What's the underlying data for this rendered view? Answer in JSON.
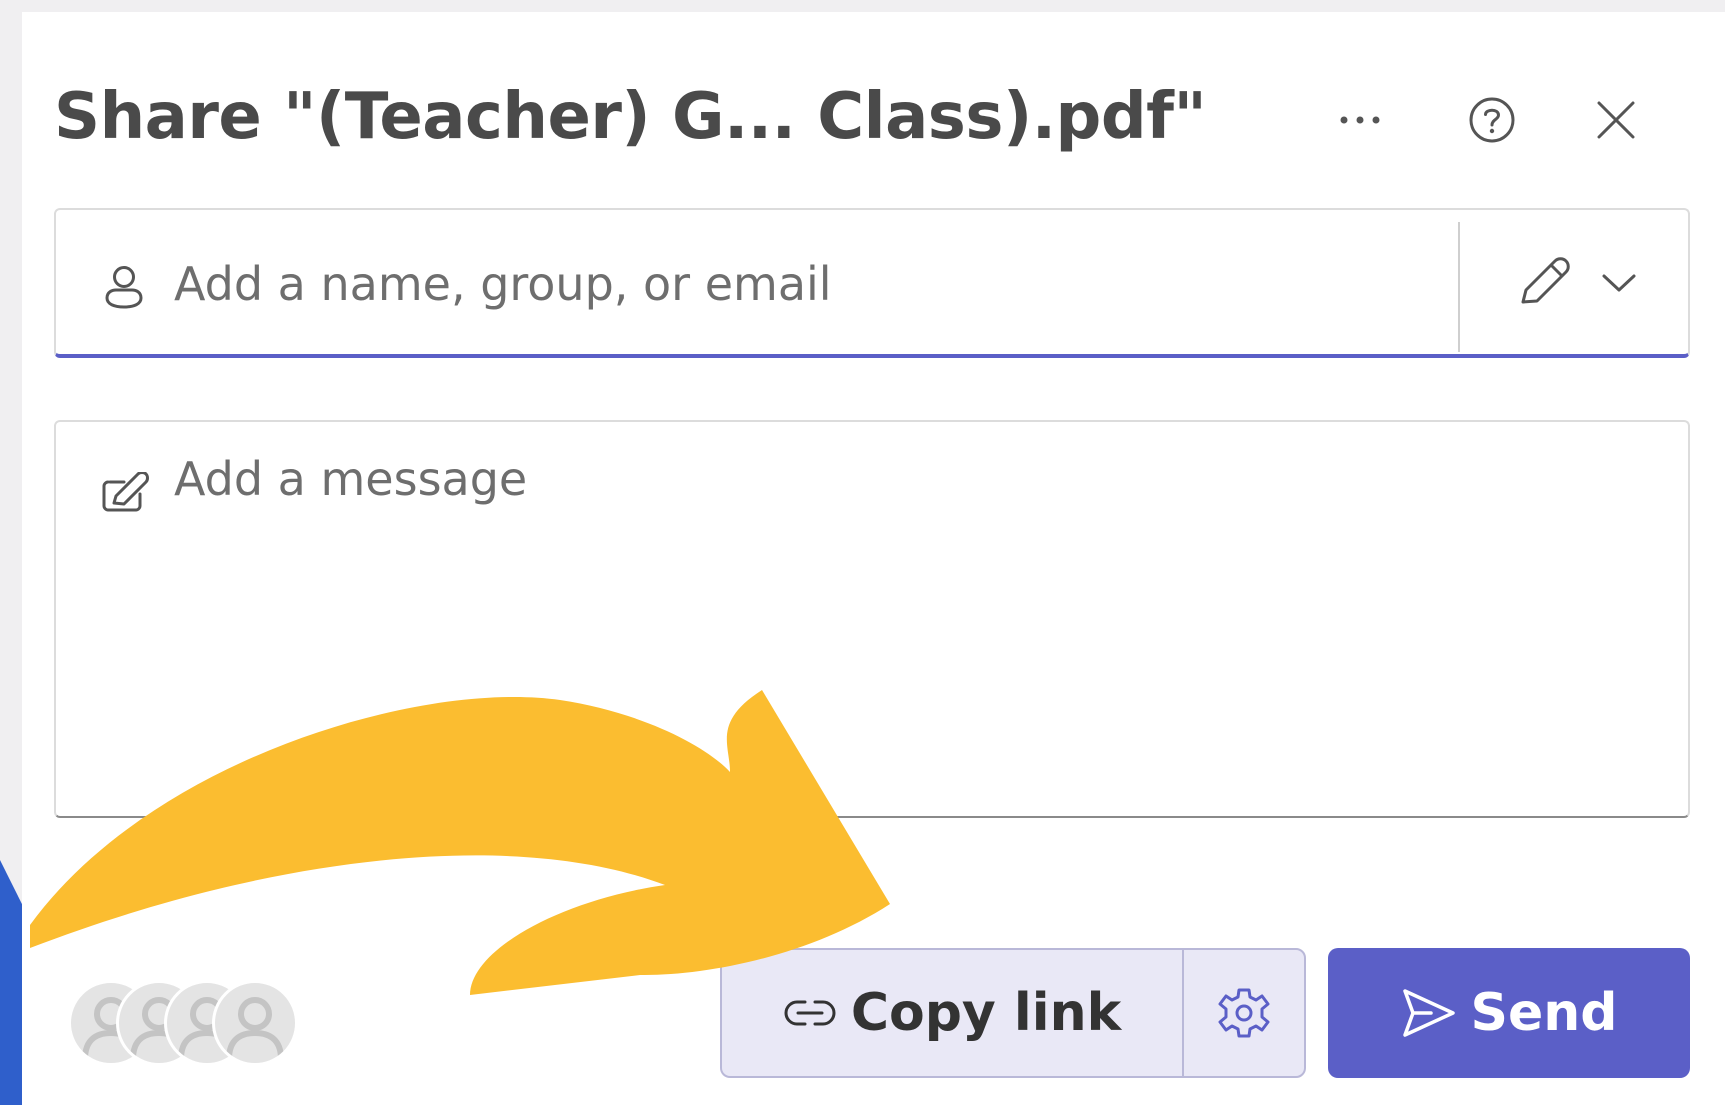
{
  "dialog": {
    "title": "Share \"(Teacher) G... Class).pdf\"",
    "more_icon": "ellipsis-icon",
    "help_icon": "question-circle-icon",
    "close_icon": "close-icon"
  },
  "people_field": {
    "placeholder": "Add a name, group, or email",
    "value": "",
    "icon": "person-icon",
    "permission_icon": "pencil-icon",
    "permission_dropdown_icon": "chevron-down-icon"
  },
  "message_field": {
    "placeholder": "Add a message",
    "value": "",
    "icon": "compose-icon"
  },
  "shared_with": {
    "avatar_count": 4,
    "icon": "person-avatar-icon"
  },
  "actions": {
    "copy_link_label": "Copy link",
    "copy_link_icon": "link-icon",
    "link_settings_icon": "gear-icon",
    "send_label": "Send",
    "send_icon": "send-icon"
  },
  "colors": {
    "accent": "#5b5fc7",
    "copy_link_bg": "#e9e8f6",
    "annotation_arrow": "#fbbd30",
    "blue_strip": "#2f5fcb",
    "title_text": "#4a4a4a"
  }
}
